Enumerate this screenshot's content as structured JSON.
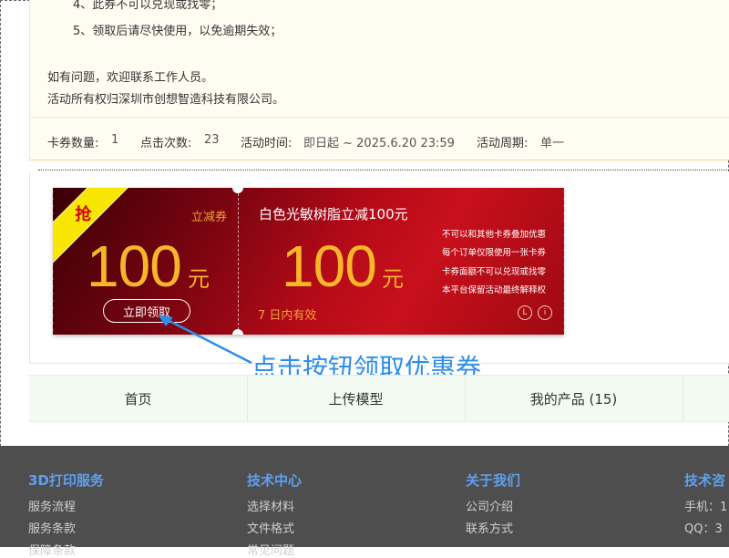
{
  "notice": {
    "rule4": "4、此券不可以兑现或找零；",
    "rule5": "5、领取后请尽快使用，以免逾期失效；",
    "contact": "如有问题，欢迎联系工作人员。",
    "ownership": "活动所有权归深圳市创想智造科技有限公司。"
  },
  "stats": {
    "count_label": "卡券数量:",
    "count_value": "1",
    "clicks_label": "点击次数:",
    "clicks_value": "23",
    "time_label": "活动时间:",
    "time_value": "即日起 ~ 2025.6.20 23:59",
    "period_label": "活动周期:",
    "period_value": "单一"
  },
  "coupon": {
    "ribbon_text": "抢",
    "type_label": "立减券",
    "amount_left": "100",
    "unit_left": "元",
    "claim_button": "立即领取",
    "title": "白色光敏树脂立减100元",
    "amount_right": "100",
    "unit_right": "元",
    "rules": [
      "不可以和其他卡券叠加优惠",
      "每个订单仅限使用一张卡券",
      "卡券面额不可以兑现或找零",
      "本平台保留活动最终解释权"
    ],
    "validity": "7 日内有效",
    "icon_l": "L",
    "icon_i": "i",
    "accent_color": "#f7b62a",
    "bg_color": "#b60a18"
  },
  "annotation": "点击按钮领取优惠券",
  "nav": {
    "items": [
      "首页",
      "上传模型",
      "我的产品 (15)",
      ""
    ]
  },
  "footer": {
    "col1": {
      "title": "3D打印服务",
      "links": [
        "服务流程",
        "服务条款",
        "保障条款"
      ]
    },
    "col2": {
      "title": "技术中心",
      "links": [
        "选择材料",
        "文件格式",
        "常见问题"
      ]
    },
    "col3": {
      "title": "关于我们",
      "links": [
        "公司介绍",
        "联系方式"
      ]
    },
    "col4": {
      "title": "技术咨",
      "links": [
        "手机：1",
        "QQ：3"
      ]
    }
  }
}
